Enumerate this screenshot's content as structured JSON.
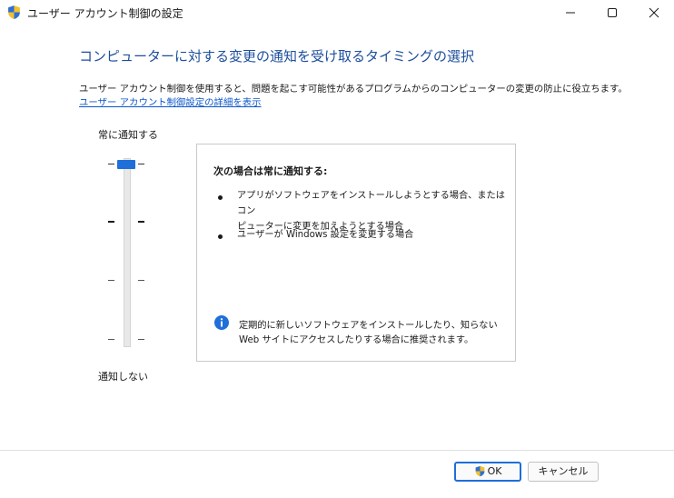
{
  "window": {
    "title": "ユーザー アカウント制御の設定"
  },
  "header": {
    "heading": "コンピューターに対する変更の通知を受け取るタイミングの選択",
    "description": "ユーザー アカウント制御を使用すると、問題を起こす可能性があるプログラムからのコンピューターの変更の防止に役立ちます。",
    "help_link": "ユーザー アカウント制御設定の詳細を表示"
  },
  "slider": {
    "top_label": "常に通知する",
    "bottom_label": "通知しない",
    "levels": 4,
    "selected_level": 4,
    "thumb_color": "#1e6fd9"
  },
  "panel": {
    "title": "次の場合は常に通知する:",
    "bullet1_line1": "アプリがソフトウェアをインストールしようとする場合、またはコン",
    "bullet1_line2": "ピューターに変更を加えようとする場合",
    "bullet2": "ユーザーが Windows 設定を変更する場合",
    "recommendation_line1": "定期的に新しいソフトウェアをインストールしたり、知らない",
    "recommendation_line2": "Web サイトにアクセスしたりする場合に推奨されます。"
  },
  "buttons": {
    "ok": "OK",
    "cancel": "キャンセル"
  },
  "colors": {
    "heading": "#1c4e9c",
    "link": "#0b57c9",
    "accent": "#1e6fd9"
  },
  "icons": {
    "title": "uac-shield-icon",
    "minimize": "minimize-icon",
    "maximize": "maximize-icon",
    "close": "close-icon",
    "info": "info-icon",
    "ok": "uac-shield-icon"
  }
}
